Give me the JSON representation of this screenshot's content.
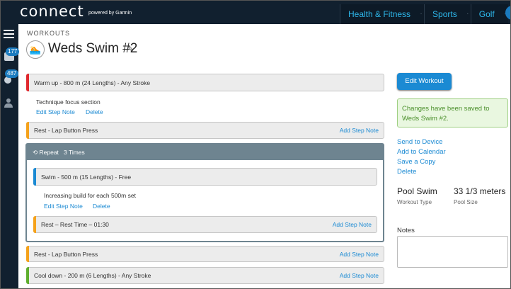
{
  "app": {
    "logo": "connect",
    "logo_sub": "powered by Garmin"
  },
  "nav": {
    "items": [
      "Health & Fitness",
      "Sports",
      "Golf"
    ]
  },
  "rail": {
    "inbox_badge": "177",
    "connections_badge": "487"
  },
  "header": {
    "section": "WORKOUTS",
    "title": "Weds Swim #2"
  },
  "steps": {
    "warmup": "Warm up - 800 m (24 Lengths) - Any Stroke",
    "warmup_note": "Technique focus section",
    "edit_step_note": "Edit Step Note",
    "delete": "Delete",
    "rest1": "Rest - Lap Button Press",
    "add_step_note": "Add Step Note",
    "repeat": "Repeat",
    "repeat_count": "3 Times",
    "swim": "Swim - 500 m (15 Lengths) - Free",
    "swim_note": "Increasing build for each 500m set",
    "rest_time": "Rest – Rest Time – 01:30",
    "rest2": "Rest - Lap Button Press",
    "cooldown": "Cool down - 200 m (6 Lengths) - Any Stroke"
  },
  "sidebar": {
    "edit_button": "Edit Workout",
    "saved_message": "Changes have been saved to Weds Swim #2.",
    "actions": [
      "Send to Device",
      "Add to Calendar",
      "Save a Copy",
      "Delete"
    ],
    "workout_type_value": "Pool Swim",
    "workout_type_label": "Workout Type",
    "pool_size_value": "33 1/3 meters",
    "pool_size_label": "Pool Size",
    "notes_label": "Notes"
  },
  "colors": {
    "warmup": "#e0282e",
    "rest": "#f5a21b",
    "active": "#1b8ad3",
    "cooldown": "#5fae2e"
  }
}
